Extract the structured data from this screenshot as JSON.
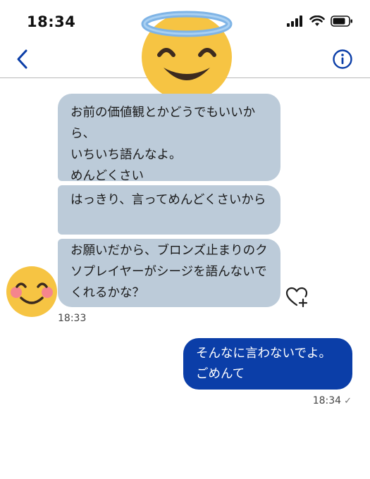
{
  "status_bar": {
    "time": "18:34"
  },
  "header": {
    "back_icon": "chevron-left-icon",
    "info_icon": "info-circle-icon",
    "contact_avatar": "smiling-face-with-halo-emoji"
  },
  "colors": {
    "accent": "#0b3ea8",
    "received_bubble": "#bccbd9",
    "sent_bubble": "#0b3ea8"
  },
  "messages": {
    "received": [
      {
        "text": "お前の価値観とかどうでもいいから、\nいちいち語んなよ。\nめんどくさい"
      },
      {
        "text": "はっきり、言ってめんどくさいから"
      },
      {
        "text": "お願いだから、ブロンズ止まりのクソプレイヤーがシージを語んないでくれるかな？"
      }
    ],
    "received_time": "18:33",
    "sender_avatar": "smiling-face-with-smiling-eyes-emoji",
    "react_icon": "heart-plus-icon",
    "sent": [
      {
        "text": "そんなに言わないでよ。\nごめんて"
      }
    ],
    "sent_time": "18:34",
    "sent_status_icon": "checkmark-icon"
  }
}
